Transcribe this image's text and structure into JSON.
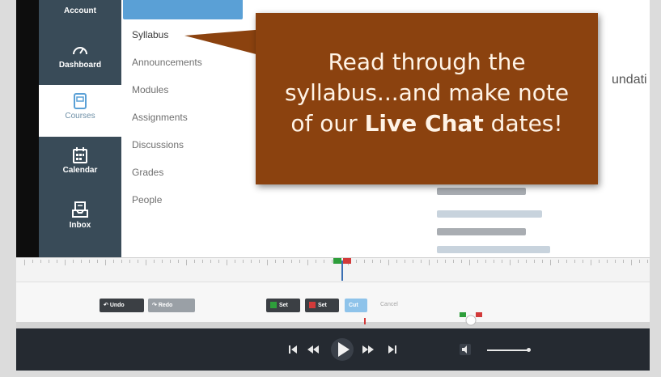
{
  "canvas_nav": {
    "account": "Account",
    "dashboard": "Dashboard",
    "courses": "Courses",
    "calendar": "Calendar",
    "inbox": "Inbox"
  },
  "course_nav": {
    "items": [
      "Syllabus",
      "Announcements",
      "Modules",
      "Assignments",
      "Discussions",
      "Grades",
      "People"
    ]
  },
  "page": {
    "partial_heading": "undati"
  },
  "callout": {
    "line1": "Read through the",
    "line2": "syllabus...and make note",
    "line3_prefix": "of our ",
    "line3_bold": "Live Chat",
    "line3_suffix": " dates!"
  },
  "editor": {
    "undo_label": "Undo",
    "redo_label": "Redo",
    "set_in_label": "Set",
    "set_out_label": "Set",
    "cut_label": "Cut",
    "cancel_label": "Cancel"
  },
  "colors": {
    "callout_bg": "#8b420f",
    "nav_bg": "#394b58",
    "active_blue": "#5aa0d6",
    "marker_green": "#2e9e3b",
    "marker_red": "#d23a3a",
    "cut_blue": "#8ec3ea",
    "player_bg": "#252a31"
  }
}
